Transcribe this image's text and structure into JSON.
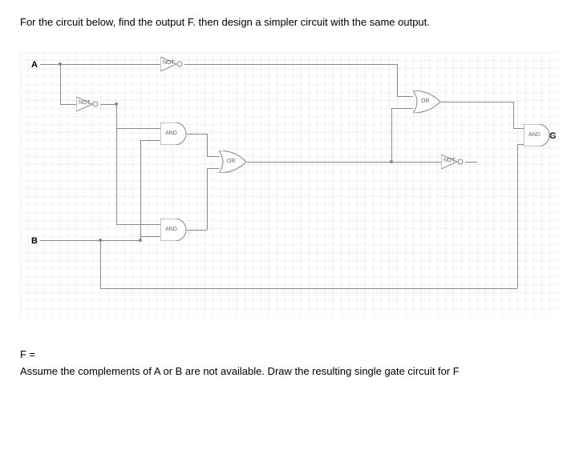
{
  "prompt": "For the circuit below, find the output F. then design a simpler circuit with the same output.",
  "inputs": {
    "A": "A",
    "B": "B"
  },
  "outputs": {
    "G": "G"
  },
  "gates": {
    "not1": "NOT",
    "not2": "NOT",
    "not3": "NOT",
    "and1": "AND",
    "and2": "AND",
    "and3": "AND",
    "or1": "OR",
    "or2": "OR"
  },
  "footer": {
    "f_equals": "F =",
    "assumption": "Assume the complements of A or B are not available. Draw the resulting single gate circuit for F"
  }
}
